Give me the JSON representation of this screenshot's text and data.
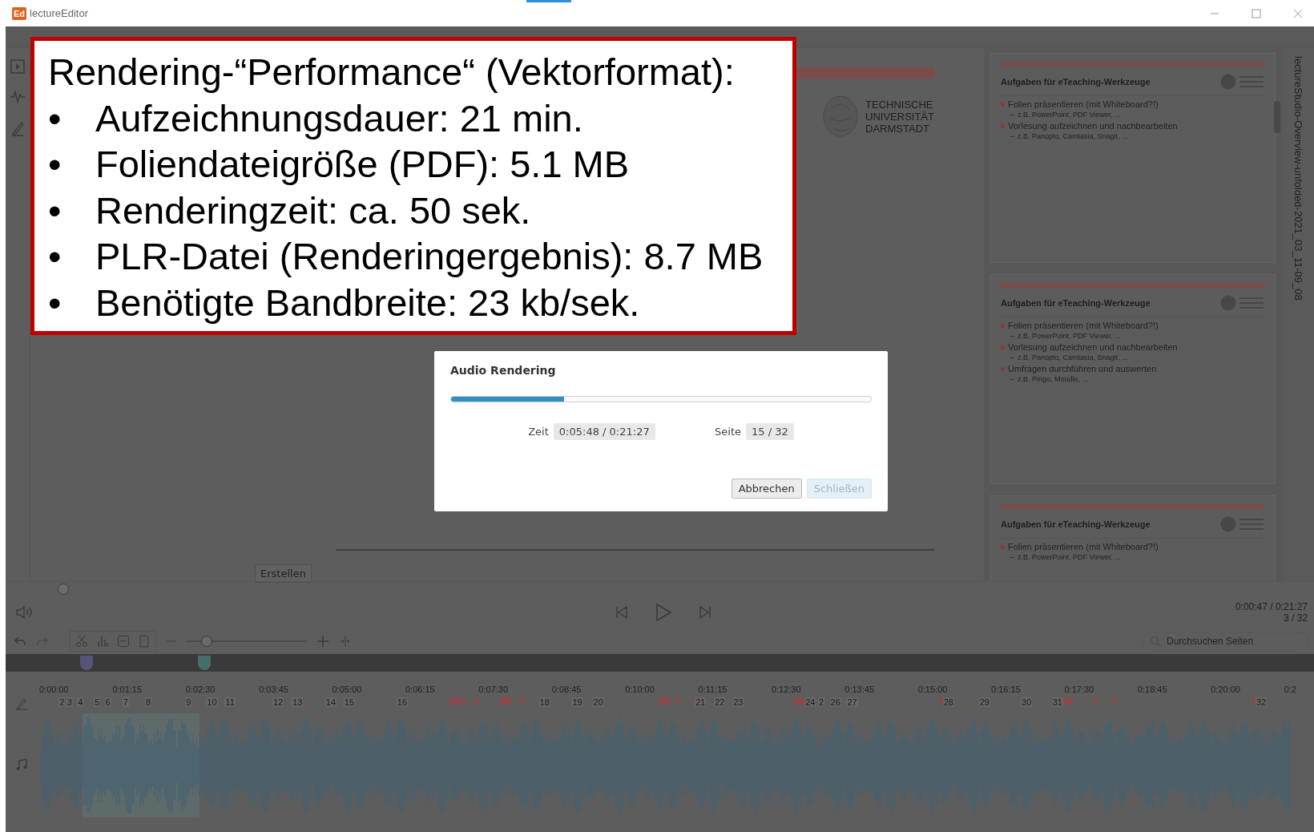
{
  "window": {
    "title": "lectureEditor",
    "app_icon": "Ed"
  },
  "callout": {
    "heading": "Rendering-“Performance“ (Vektorformat):",
    "items": [
      {
        "bullet": "•",
        "text": "Aufzeichnungsdauer: 21 min."
      },
      {
        "bullet": "•",
        "text": "Foliendateigröße (PDF): 5.1 MB"
      },
      {
        "bullet": "•",
        "text": "Renderingzeit: ca. 50 sek."
      },
      {
        "bullet": "•",
        "text": "PLR-Datei (Renderingergebnis): 8.7 MB"
      },
      {
        "bullet": "•",
        "text": "Benötigte Bandbreite: 23 kb/sek."
      }
    ]
  },
  "slide": {
    "logo_text": [
      "TECHNISCHE",
      "UNIVERSITÄT",
      "DARMSTADT"
    ]
  },
  "create_button": "Erstellen",
  "dialog": {
    "title": "Audio Rendering",
    "level": 0.27,
    "fields": [
      {
        "label": "Zeit",
        "value": "0:05:48 / 0:21:27"
      },
      {
        "label": "Seite",
        "value": "15 / 32"
      }
    ],
    "buttons": [
      {
        "label": "Abbrechen",
        "disabled": false
      },
      {
        "label": "Schließen",
        "disabled": true
      }
    ]
  },
  "thumbnails": [
    {
      "title": "Aufgaben für eTeaching-Werkzeuge",
      "bullets": [
        {
          "text": "Folien präsentieren (mit Whiteboard?!)",
          "children": [
            {
              "dash": "–",
              "text": "z.B. PowerPoint, PDF Viewer, ..."
            }
          ]
        },
        {
          "text": "Vorlesung aufzeichnen und nachbearbeiten",
          "children": [
            {
              "dash": "–",
              "text": "z.B. Panopto, Camtasia, Snagit, ..."
            }
          ]
        }
      ]
    },
    {
      "title": "Aufgaben für eTeaching-Werkzeuge",
      "bullets": [
        {
          "text": "Folien präsentieren (mit Whiteboard?!)",
          "children": [
            {
              "dash": "–",
              "text": "z.B. PowerPoint, PDF Viewer, ..."
            }
          ]
        },
        {
          "text": "Vorlesung aufzeichnen und nachbearbeiten",
          "children": [
            {
              "dash": "–",
              "text": "z.B. Panopto, Camtasia, Snagit, ..."
            }
          ]
        },
        {
          "text": "Umfragen durchführen und auswerten",
          "children": [
            {
              "dash": "–",
              "text": "z.B. Pingo, Moodle, ..."
            }
          ]
        }
      ]
    },
    {
      "title": "Aufgaben für eTeaching-Werkzeuge",
      "bullets": [
        {
          "text": "Folien präsentieren (mit Whiteboard?!)",
          "children": [
            {
              "dash": "–",
              "text": "z.B. PowerPoint, PDF Viewer, ..."
            }
          ]
        }
      ]
    }
  ],
  "document_name": "lectureStudio-Overview-unfolded-2021_03_11-09_08",
  "player": {
    "time": "0:00:47 / 0:21:27",
    "page": "3 / 32"
  },
  "search": {
    "placeholder": "Durchsuchen Seiten"
  },
  "zoom": {
    "level": 0.13
  },
  "timeline": {
    "ticks": [
      "0:00:00",
      "0:01:15",
      "0:02:30",
      "0:03:45",
      "0:05:00",
      "0:06:15",
      "0:07:30",
      "0:08:45",
      "0:10:00",
      "0:11:15",
      "0:12:30",
      "0:13:45",
      "0:15:00",
      "0:16:15",
      "0:17:30",
      "0:18:45",
      "0:20:00",
      "0:2"
    ],
    "pages": [
      "2",
      "3",
      "4",
      "5",
      "6",
      "7",
      "8",
      "9",
      "10",
      "11",
      "12",
      "13",
      "14",
      "15",
      "16",
      "18",
      "19",
      "20",
      "21",
      "22",
      "23",
      "24",
      "2",
      "26",
      "27",
      "28",
      "29",
      "30",
      "31",
      "32"
    ]
  }
}
